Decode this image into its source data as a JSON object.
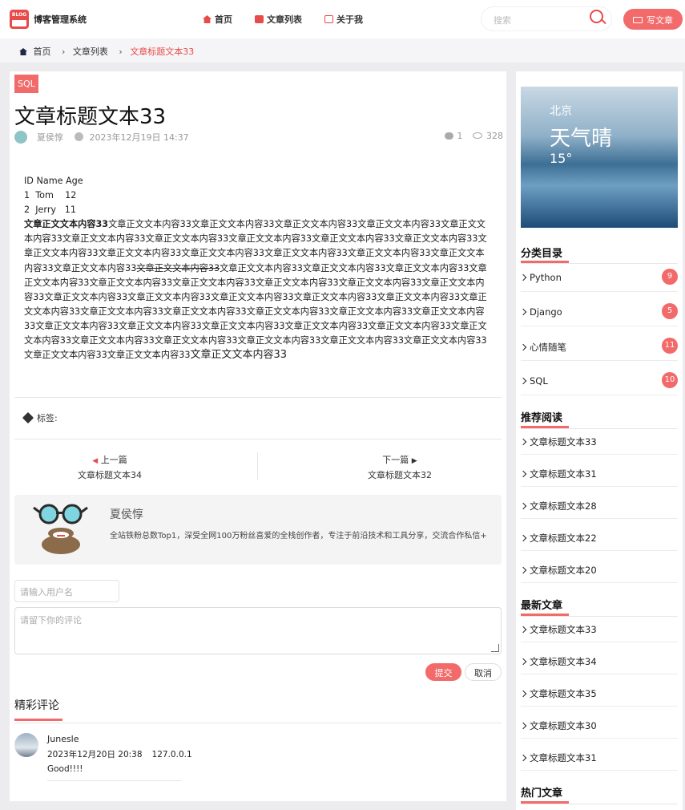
{
  "header": {
    "logo_text": "BLOG",
    "site_name": "博客管理系统",
    "nav": [
      {
        "label": "首页",
        "icon": "home-icon",
        "color": "#e94a4a"
      },
      {
        "label": "文章列表",
        "icon": "article-list-icon",
        "color": "#e94a4a"
      },
      {
        "label": "关于我",
        "icon": "about-icon",
        "color": "#e94a4a"
      }
    ],
    "search_placeholder": "搜索",
    "write_label": "写文章"
  },
  "breadcrumb": {
    "home": "首页",
    "list": "文章列表",
    "current": "文章标题文本33"
  },
  "article": {
    "category": "SQL",
    "title": "文章标题文本33",
    "author": "夏侯惇",
    "date": "2023年12月19日 14:37",
    "comments": "1",
    "views": "328",
    "table_header": "ID Name Age",
    "table_rows": [
      "1  Tom    12",
      "2  Jerry   11"
    ],
    "body_lead": "文章正文文本内容33",
    "body_part1": "文章正文文本内容33文章正文文本内容33文章正文文本内容33文章正文文本内容33文章正文文本内容33文章正文文本内容33文章正文文本内容33文章正文文本内容33文章正文文本内容33文章正文文本内容33文章正文文本内容33文章正文文本内容33文章正文文本内容33文章正文文本内容33文章正文文本内容33文章正文文本内容33文章正文文本内容33",
    "body_strike": "文章正文文本内容33",
    "body_part2": "文章正文文本内容33文章正文文本内容33文章正文文本内容33文章正文文本内容33文章正文文本内容33文章正文文本内容33文章正文文本内容33文章正文文本内容33文章正文文本内容33文章正文文本内容33文章正文文本内容33文章正文文本内容33文章正文文本内容33文章正文文本内容33文章正文文本内容33文章正文文本内容33文章正文文本内容33文章正文文本内容33文章正文文本内容33文章正文文本内容33文章正文文本内容33文章正文文本内容33文章正文文本内容33文章正文文本内容33文章正文文本内容33文章正文文本内容33文章正文文本内容33文章正文文本内容33文章正文文本内容33文章正文文本内容33文章正文文本内容33文章正文文本内容33文章正文文本内容33",
    "body_tail": "文章正文文本内容33",
    "tags_label": "标签:",
    "prev_label": "上一篇",
    "prev_title": "文章标题文本34",
    "next_label": "下一篇",
    "next_title": "文章标题文本32"
  },
  "author_box": {
    "name": "夏侯惇",
    "description": "全站铁粉总数Top1，深受全网100万粉丝喜爱的全栈创作者，专注于前沿技术和工具分享，交流合作私信+"
  },
  "comment_form": {
    "name_placeholder": "请输入用户名",
    "content_placeholder": "请留下你的评论",
    "submit_label": "提交",
    "cancel_label": "取消"
  },
  "comments": {
    "title": "精彩评论",
    "items": [
      {
        "user": "Junesle",
        "time": "2023年12月20日 20:38",
        "ip": "127.0.0.1",
        "text": "Good!!!!"
      }
    ]
  },
  "sidebar": {
    "weather": {
      "city": "北京",
      "desc": "天气晴",
      "temp": "15°"
    },
    "categories_title": "分类目录",
    "categories": [
      {
        "name": "Python",
        "count": "9"
      },
      {
        "name": "Django",
        "count": "5"
      },
      {
        "name": "心情随笔",
        "count": "11"
      },
      {
        "name": "SQL",
        "count": "10"
      }
    ],
    "recommend_title": "推荐阅读",
    "recommend": [
      "文章标题文本33",
      "文章标题文本31",
      "文章标题文本28",
      "文章标题文本22",
      "文章标题文本20"
    ],
    "latest_title": "最新文章",
    "latest": [
      "文章标题文本33",
      "文章标题文本34",
      "文章标题文本35",
      "文章标题文本30",
      "文章标题文本31"
    ],
    "hot_title": "热门文章"
  },
  "colors": {
    "accent": "#f26a6a",
    "brand": "#e94a4a"
  }
}
